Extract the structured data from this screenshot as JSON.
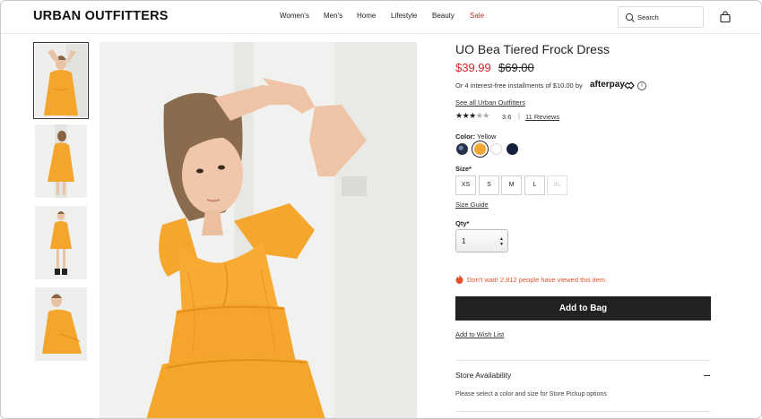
{
  "brand": {
    "logo_text": "URBAN OUTFITTERS"
  },
  "nav": {
    "items": [
      {
        "label": "Women's"
      },
      {
        "label": "Men's"
      },
      {
        "label": "Home"
      },
      {
        "label": "Lifestyle"
      },
      {
        "label": "Beauty"
      },
      {
        "label": "Sale"
      }
    ],
    "sale_color": "#d0242b"
  },
  "search": {
    "placeholder": "Search",
    "icon": "search-icon"
  },
  "cart": {
    "icon": "shopping-bag-icon"
  },
  "gallery": {
    "thumbnails": [
      {
        "alt": "Model in yellow tiered dress with arms raised",
        "selected": true
      },
      {
        "alt": "Model in yellow tiered dress side view"
      },
      {
        "alt": "Model in yellow tiered dress full length"
      },
      {
        "alt": "Model in yellow tiered dress seated"
      }
    ],
    "main_image_alt": "Model wearing UO Bea Tiered Frock Dress in yellow"
  },
  "product": {
    "title": "UO Bea Tiered Frock Dress",
    "sale_price": "$39.99",
    "original_price": "$69.00",
    "installments_text": "Or 4 interest-free installments of $10.00 by",
    "afterpay_label": "afterpay",
    "see_all_label": "See all Urban Outfitters",
    "rating_value": "3.6",
    "rating_stars": 3.6,
    "reviews_label": "11 Reviews",
    "color_label": "Color:",
    "color_value": "Yellow",
    "colors": [
      {
        "name": "Navy Print",
        "hex": "#26314a"
      },
      {
        "name": "Yellow",
        "hex": "#f1a733",
        "selected": true
      },
      {
        "name": "White",
        "hex": "#ffffff"
      },
      {
        "name": "Navy",
        "hex": "#14213d"
      }
    ],
    "size_label": "Size*",
    "sizes": [
      {
        "label": "XS",
        "available": true
      },
      {
        "label": "S",
        "available": true
      },
      {
        "label": "M",
        "available": true
      },
      {
        "label": "L",
        "available": true
      },
      {
        "label": "XL",
        "available": false
      }
    ],
    "size_guide_label": "Size Guide",
    "qty_label": "Qty*",
    "qty_value": "1",
    "urgency_text": "Don't wait! 2,812 people have viewed this item.",
    "urgency_color": "#e2522b",
    "add_to_bag_label": "Add to Bag",
    "wishlist_label": "Add to Wish List",
    "store_availability_title": "Store Availability",
    "store_availability_note": "Please select a color and size for Store Pickup options"
  }
}
